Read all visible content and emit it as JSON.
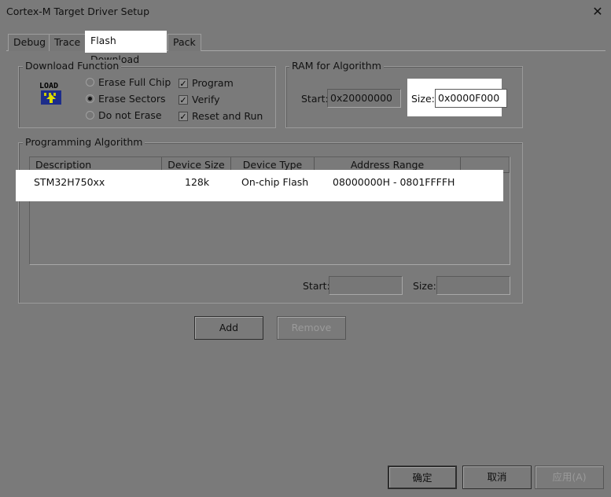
{
  "window": {
    "title": "Cortex-M Target Driver Setup",
    "close_glyph": "✕"
  },
  "tabs": [
    {
      "label": "Debug"
    },
    {
      "label": "Trace"
    },
    {
      "label": "Flash Download"
    },
    {
      "label": "Pack"
    }
  ],
  "download_function": {
    "legend": "Download Function",
    "icon_text": "LOAD",
    "radios": [
      {
        "label": "Erase Full Chip",
        "selected": false
      },
      {
        "label": "Erase Sectors",
        "selected": true
      },
      {
        "label": "Do not Erase",
        "selected": false
      }
    ],
    "checks": [
      {
        "label": "Program",
        "checked": true
      },
      {
        "label": "Verify",
        "checked": true
      },
      {
        "label": "Reset and Run",
        "checked": true
      }
    ]
  },
  "ram": {
    "legend": "RAM for Algorithm",
    "start_label": "Start:",
    "start_value": "0x20000000",
    "size_label": "Size:",
    "size_value": "0x0000F000"
  },
  "algorithm": {
    "legend": "Programming Algorithm",
    "columns": [
      "Description",
      "Device Size",
      "Device Type",
      "Address Range"
    ],
    "rows": [
      {
        "description": "STM32H750xx",
        "size": "128k",
        "type": "On-chip Flash",
        "range": "08000000H - 0801FFFFH"
      }
    ],
    "start_label": "Start:",
    "start_value": "",
    "size_label": "Size:",
    "size_value": ""
  },
  "buttons": {
    "add": "Add",
    "remove": "Remove",
    "ok": "确定",
    "cancel": "取消",
    "apply": "应用(A)"
  },
  "check_glyph": "✓"
}
